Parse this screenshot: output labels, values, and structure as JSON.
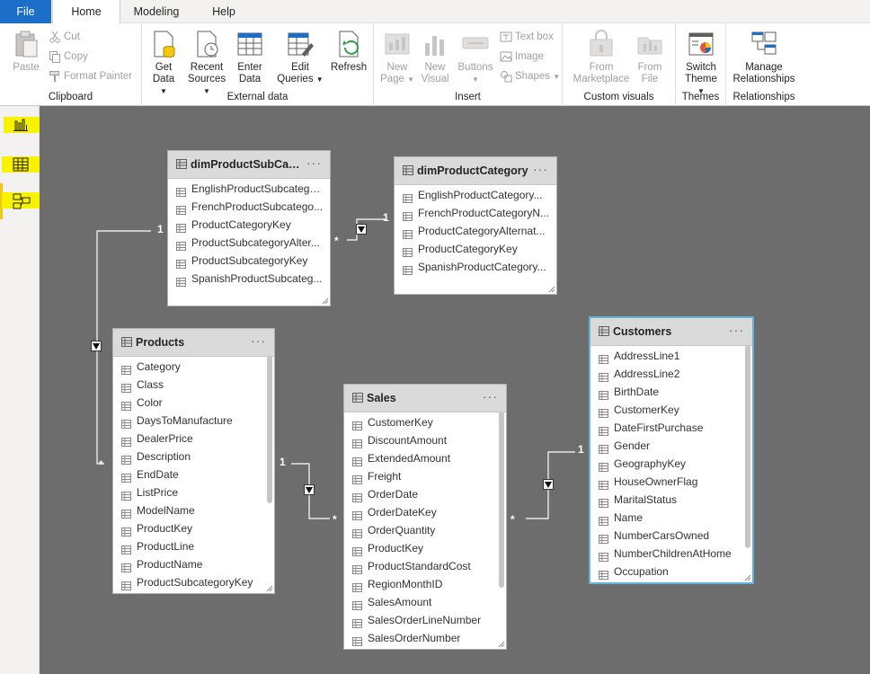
{
  "tabs": [
    "File",
    "Home",
    "Modeling",
    "Help"
  ],
  "ribbon": {
    "clipboard": {
      "label": "Clipboard",
      "paste": "Paste",
      "cut": "Cut",
      "copy": "Copy",
      "format_painter": "Format Painter"
    },
    "external_data": {
      "label": "External data",
      "get_data": [
        "Get",
        "Data"
      ],
      "recent_sources": [
        "Recent",
        "Sources"
      ],
      "enter_data": [
        "Enter",
        "Data"
      ],
      "edit_queries": [
        "Edit",
        "Queries"
      ],
      "refresh": "Refresh"
    },
    "insert": {
      "label": "Insert",
      "new_page": [
        "New",
        "Page"
      ],
      "new_visual": [
        "New",
        "Visual"
      ],
      "buttons": "Buttons",
      "text_box": "Text box",
      "image": "Image",
      "shapes": "Shapes"
    },
    "custom_visuals": {
      "label": "Custom visuals",
      "from_marketplace": [
        "From",
        "Marketplace"
      ],
      "from_file": [
        "From",
        "File"
      ]
    },
    "themes": {
      "label": "Themes",
      "switch_theme": [
        "Switch",
        "Theme"
      ]
    },
    "relationships": {
      "label": "Relationships",
      "manage": [
        "Manage",
        "Relationships"
      ]
    }
  },
  "tables": {
    "subcategory": {
      "name": "dimProductSubCate...",
      "fields": [
        "EnglishProductSubcatego...",
        "FrenchProductSubcatego...",
        "ProductCategoryKey",
        "ProductSubcategoryAlter...",
        "ProductSubcategoryKey",
        "SpanishProductSubcateg..."
      ]
    },
    "category": {
      "name": "dimProductCategory",
      "fields": [
        "EnglishProductCategory...",
        "FrenchProductCategoryN...",
        "ProductCategoryAlternat...",
        "ProductCategoryKey",
        "SpanishProductCategory..."
      ]
    },
    "products": {
      "name": "Products",
      "fields": [
        "Category",
        "Class",
        "Color",
        "DaysToManufacture",
        "DealerPrice",
        "Description",
        "EndDate",
        "ListPrice",
        "ModelName",
        "ProductKey",
        "ProductLine",
        "ProductName",
        "ProductSubcategoryKey"
      ]
    },
    "sales": {
      "name": "Sales",
      "fields": [
        "CustomerKey",
        "DiscountAmount",
        "ExtendedAmount",
        "Freight",
        "OrderDate",
        "OrderDateKey",
        "OrderQuantity",
        "ProductKey",
        "ProductStandardCost",
        "RegionMonthID",
        "SalesAmount",
        "SalesOrderLineNumber",
        "SalesOrderNumber"
      ]
    },
    "customers": {
      "name": "Customers",
      "fields": [
        "AddressLine1",
        "AddressLine2",
        "BirthDate",
        "CustomerKey",
        "DateFirstPurchase",
        "Gender",
        "GeographyKey",
        "HouseOwnerFlag",
        "MaritalStatus",
        "Name",
        "NumberCarsOwned",
        "NumberChildrenAtHome",
        "Occupation"
      ]
    }
  },
  "relationships": {
    "one": "1",
    "many": "*"
  },
  "colors": {
    "file_tab": "#1c6fc9",
    "canvas": "#6d6d6d",
    "highlight": "#f7f200",
    "selected_border": "#5fb4d8"
  }
}
